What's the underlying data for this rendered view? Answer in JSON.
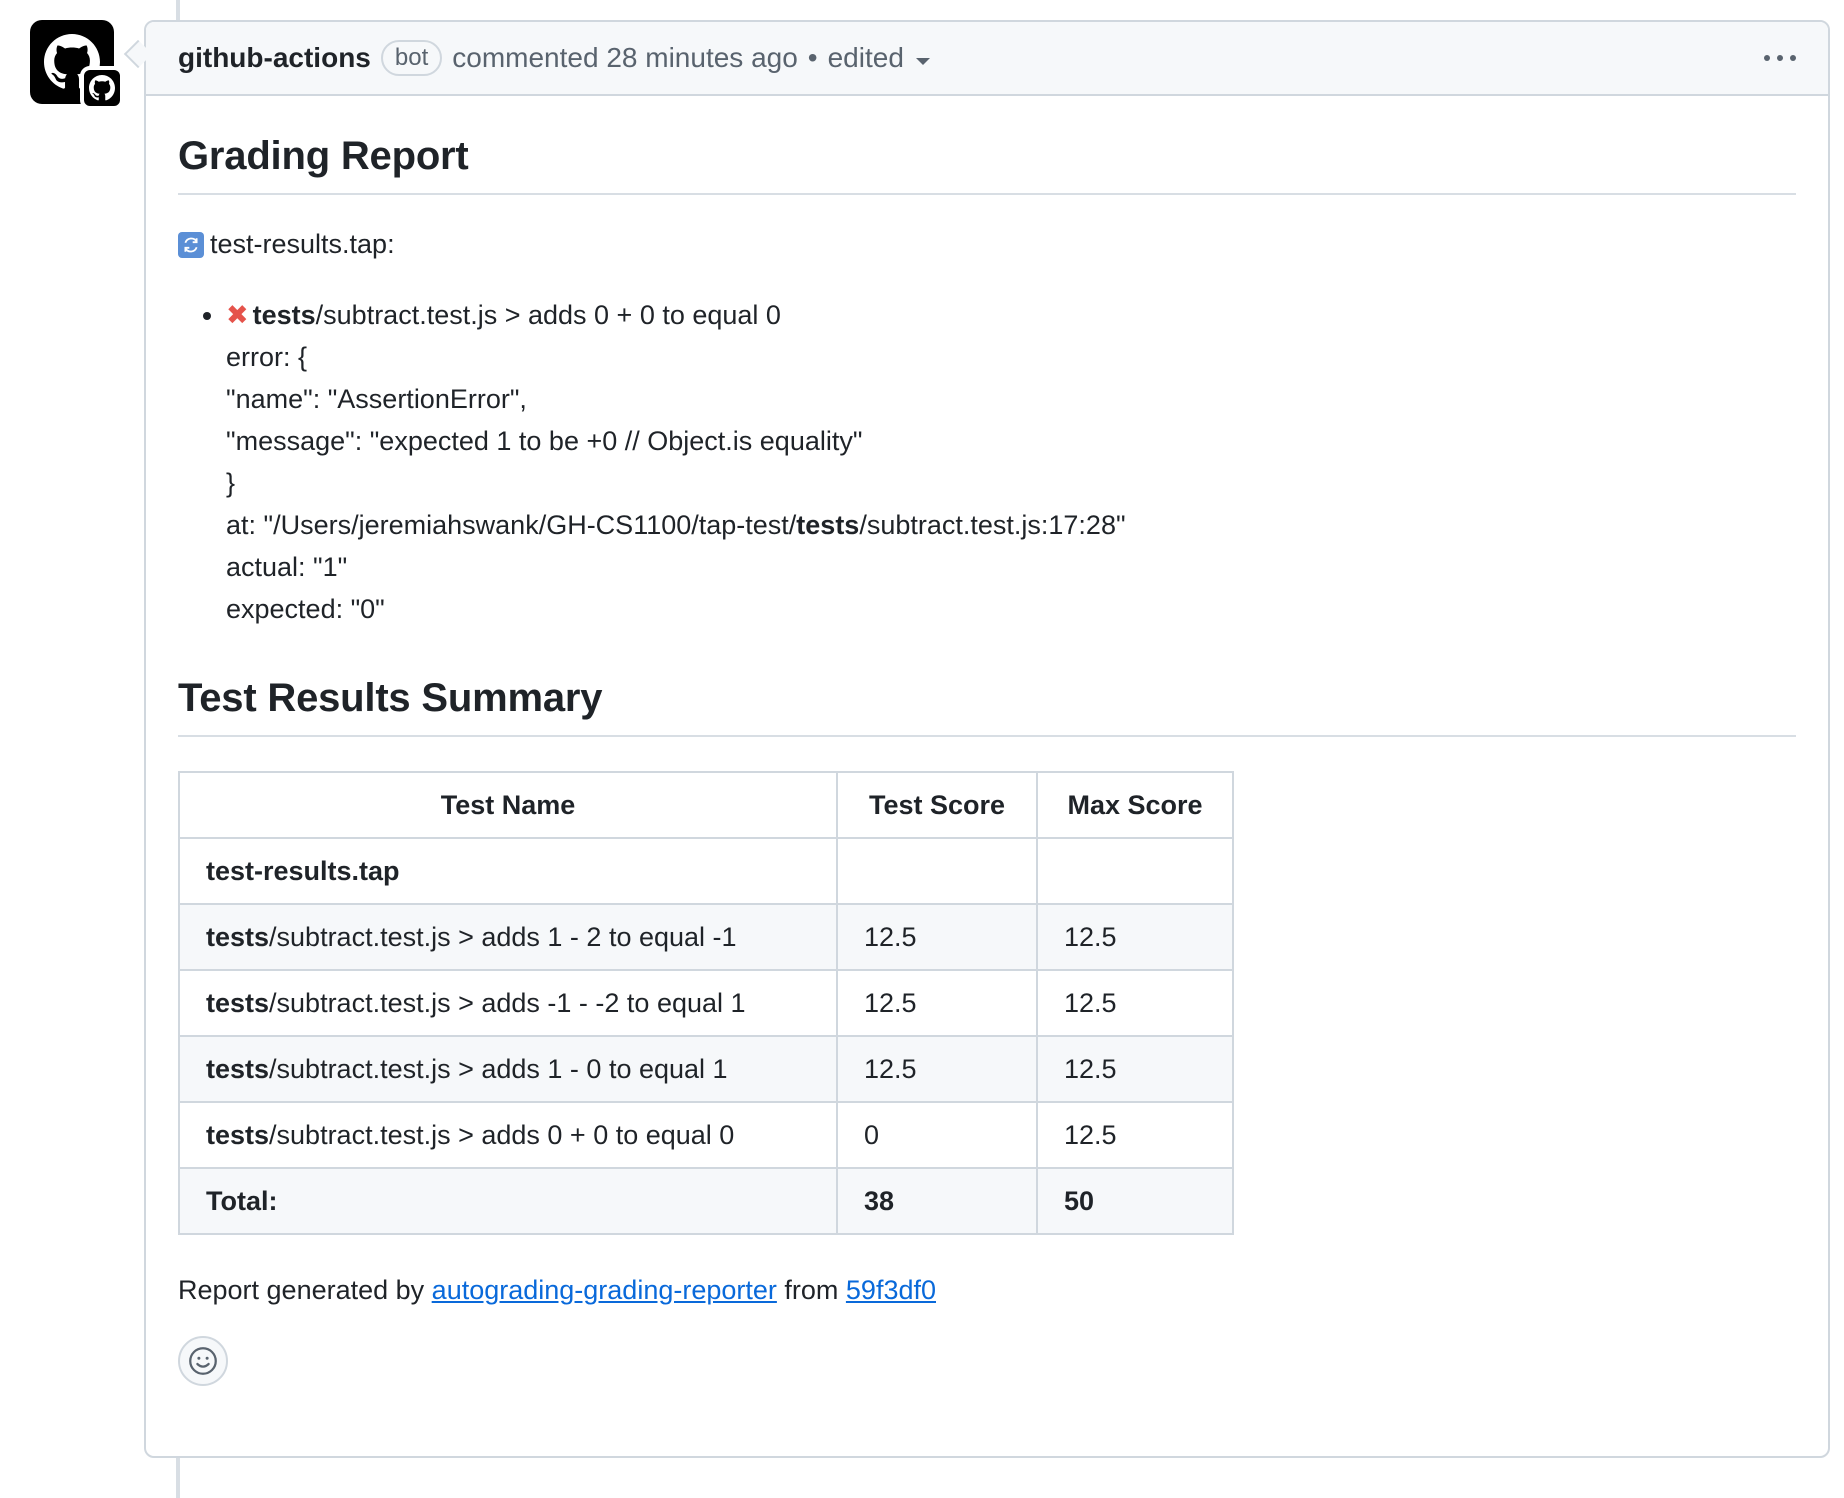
{
  "header": {
    "author": "github-actions",
    "badge": "bot",
    "action": "commented",
    "time": "28 minutes ago",
    "separator": "•",
    "edited": "edited"
  },
  "report": {
    "title": "Grading Report",
    "file": "test-results.tap:",
    "failure": {
      "bold_prefix": "tests",
      "title_rest": "/subtract.test.js > adds 0 + 0 to equal 0",
      "lines": [
        "error: {",
        "\"name\": \"AssertionError\",",
        "\"message\": \"expected 1 to be +0 // Object.is equality\"",
        "}"
      ],
      "at_prefix": "at: \"/Users/jeremiahswank/GH-CS1100/tap-test/",
      "at_bold": "tests",
      "at_suffix": "/subtract.test.js:17:28\"",
      "actual": "actual: \"1\"",
      "expected": "expected: \"0\""
    }
  },
  "summary": {
    "title": "Test Results Summary",
    "columns": [
      "Test Name",
      "Test Score",
      "Max Score"
    ],
    "group": "test-results.tap",
    "rows": [
      {
        "bold": "tests",
        "rest": "/subtract.test.js > adds 1 - 2 to equal -1",
        "score": "12.5",
        "max": "12.5"
      },
      {
        "bold": "tests",
        "rest": "/subtract.test.js > adds -1 - -2 to equal 1",
        "score": "12.5",
        "max": "12.5"
      },
      {
        "bold": "tests",
        "rest": "/subtract.test.js > adds 1 - 0 to equal 1",
        "score": "12.5",
        "max": "12.5"
      },
      {
        "bold": "tests",
        "rest": "/subtract.test.js > adds 0 + 0 to equal 0",
        "score": "0",
        "max": "12.5"
      }
    ],
    "total_label": "Total:",
    "total_score": "38",
    "total_max": "50"
  },
  "footer": {
    "prefix": "Report generated by ",
    "link1": "autograding-grading-reporter",
    "middle": " from ",
    "link2": "59f3df0"
  },
  "icons": {
    "avatar": "github-mark-icon",
    "refresh": "refresh-icon",
    "fail": "x-icon",
    "reaction": "smiley-icon",
    "menu": "kebab-icon"
  },
  "colors": {
    "link": "#0969da",
    "fail": "#e5534b",
    "border": "#d0d7de",
    "header_bg": "#f6f8fa"
  }
}
